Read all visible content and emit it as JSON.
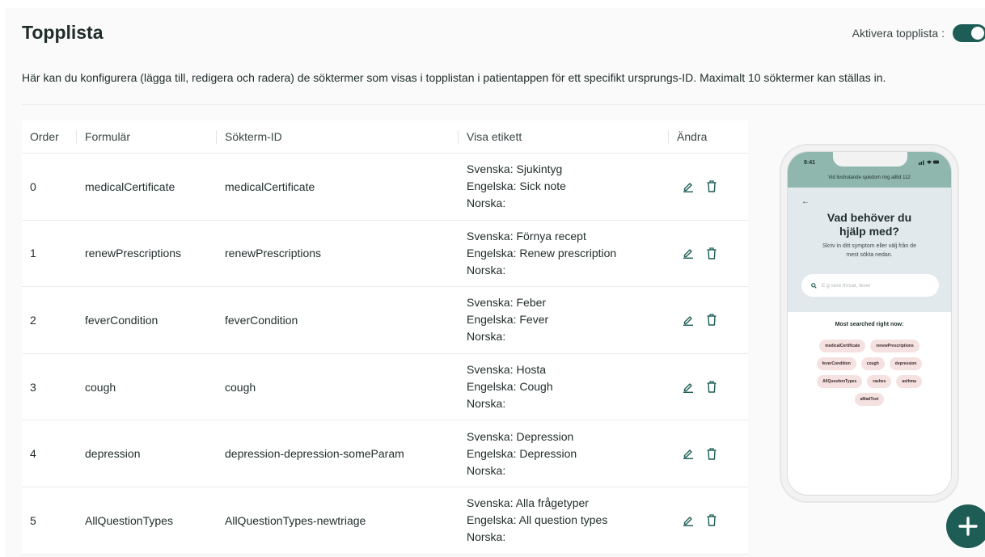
{
  "header": {
    "title": "Topplista",
    "toggle_label": "Aktivera topplista :"
  },
  "description": "Här kan du konfigurera (lägga till, redigera och radera) de söktermer som visas i topplistan i patientappen för ett specifikt ursprungs-ID. Maximalt 10 söktermer kan ställas in.",
  "table": {
    "columns": [
      "Order",
      "Formulär",
      "Sökterm-ID",
      "Visa etikett",
      "Ändra"
    ],
    "rows": [
      {
        "order": "0",
        "form": "medicalCertificate",
        "term_id": "medicalCertificate",
        "sv": "Svenska: Sjukintyg",
        "en": "Engelska: Sick note",
        "no": "Norska:"
      },
      {
        "order": "1",
        "form": "renewPrescriptions",
        "term_id": "renewPrescriptions",
        "sv": "Svenska: Förnya recept",
        "en": "Engelska: Renew prescription",
        "no": "Norska:"
      },
      {
        "order": "2",
        "form": "feverCondition",
        "term_id": "feverCondition",
        "sv": "Svenska: Feber",
        "en": "Engelska: Fever",
        "no": "Norska:"
      },
      {
        "order": "3",
        "form": "cough",
        "term_id": "cough",
        "sv": "Svenska: Hosta",
        "en": "Engelska: Cough",
        "no": "Norska:"
      },
      {
        "order": "4",
        "form": "depression",
        "term_id": "depression-depression-someParam",
        "sv": "Svenska: Depression",
        "en": "Engelska: Depression",
        "no": "Norska:"
      },
      {
        "order": "5",
        "form": "AllQuestionTypes",
        "term_id": "AllQuestionTypes-newtriage",
        "sv": "Svenska: Alla frågetyper",
        "en": "Engelska: All question types",
        "no": "Norska:"
      }
    ]
  },
  "phone_preview": {
    "time": "9:41",
    "emergency_text": "Vid livshotande sjukdom ring alltid 112",
    "back": "←",
    "heading": "Vad behöver du hjälp med?",
    "subtext": "Skriv in ditt symptom eller välj från de mest sökta nedan.",
    "search_placeholder": "E.g sore throat, fever",
    "most_searched_label": "Most searched right now:",
    "chips": [
      "medicalCertificate",
      "renewPrescriptions",
      "feverCondition",
      "cough",
      "depression",
      "AllQuestionTypes",
      "rashes",
      "asthma",
      "aMatiTest"
    ]
  },
  "colors": {
    "accent": "#1d5d55",
    "phone_header": "#8fb7ae",
    "phone_hero": "#e2e9ec",
    "chip_bg": "#f6e1e1"
  },
  "icons": {
    "edit": "pencil-icon",
    "delete": "trash-icon",
    "add": "plus-icon",
    "search": "search-icon"
  }
}
